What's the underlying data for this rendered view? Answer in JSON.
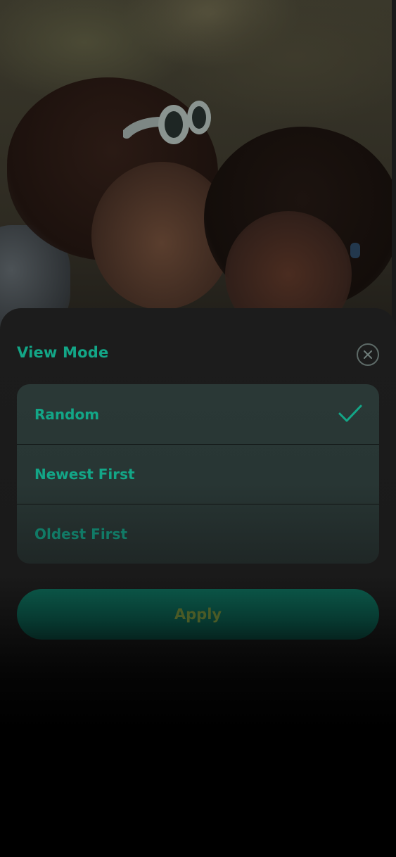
{
  "background_photo": {
    "description_icon": "photo-background"
  },
  "sheet": {
    "title": "View Mode",
    "close_icon": "close-circle-icon",
    "options": [
      {
        "label": "Random",
        "selected": true
      },
      {
        "label": "Newest First",
        "selected": false
      },
      {
        "label": "Oldest First",
        "selected": false
      }
    ],
    "check_icon": "checkmark-icon",
    "apply_label": "Apply"
  },
  "colors": {
    "accent": "#13a687",
    "sheet_bg": "#1c1c1c",
    "options_bg": "#2a3836",
    "apply_bg": "#0b5446",
    "apply_text": "#4a5a26"
  }
}
